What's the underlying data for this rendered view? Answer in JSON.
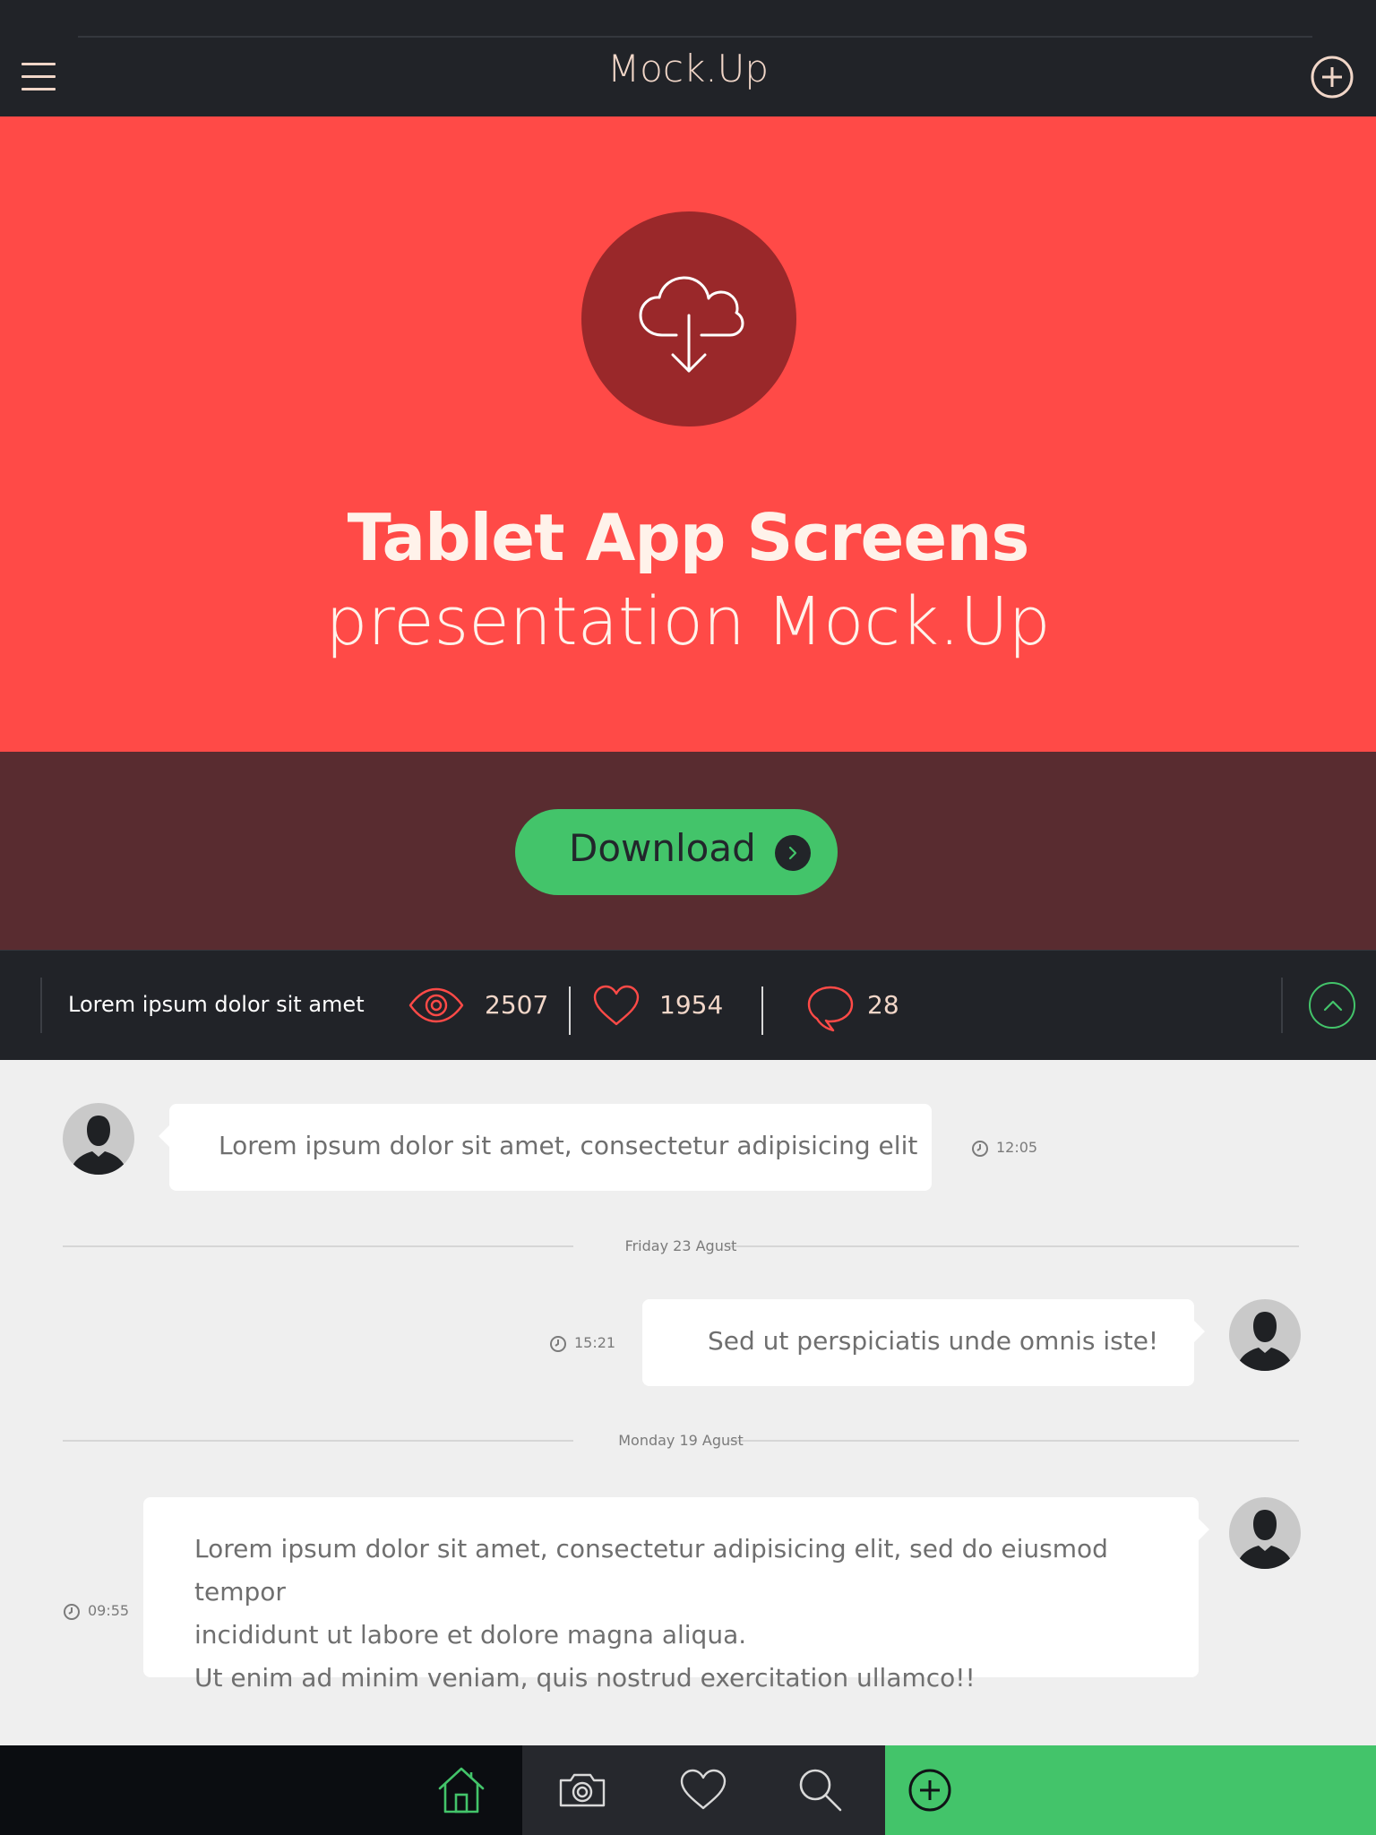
{
  "header": {
    "title": "Mock.Up"
  },
  "hero": {
    "headline": "Tablet App Screens",
    "subline": "presentation Mock.Up",
    "background": "#ff4a47",
    "icon_circle": "#9a282a"
  },
  "download": {
    "label": "Download",
    "button_color": "#43c46a",
    "strip_color": "#592c30"
  },
  "stats": {
    "caption": "Lorem ipsum dolor sit amet",
    "views": "2507",
    "likes": "1954",
    "comments": "28"
  },
  "chat": {
    "messages": [
      {
        "text": "Lorem ipsum dolor sit amet, consectetur adipisicing elit",
        "time": "12:05",
        "side": "left"
      },
      {
        "text": "Sed ut perspiciatis unde omnis iste!",
        "time": "15:21",
        "side": "right"
      },
      {
        "lines": [
          "Lorem ipsum dolor sit amet, consectetur adipisicing elit, sed do eiusmod tempor",
          "incididunt ut labore et dolore magna aliqua.",
          "Ut enim ad minim veniam, quis nostrud exercitation ullamco!!"
        ],
        "time": "09:55",
        "side": "right"
      }
    ],
    "dates": [
      "Friday 23 Agust",
      "Monday 19 Agust"
    ]
  },
  "tabbar": {
    "tabs": [
      "home-icon",
      "camera-icon",
      "heart-icon",
      "search-icon",
      "plus-icon"
    ],
    "active": "home-icon",
    "accent": "#43c46a"
  },
  "colors": {
    "dark": "#212328",
    "accent_green": "#43c46a",
    "accent_red": "#ff4a47",
    "cream": "#f1d6c8"
  }
}
